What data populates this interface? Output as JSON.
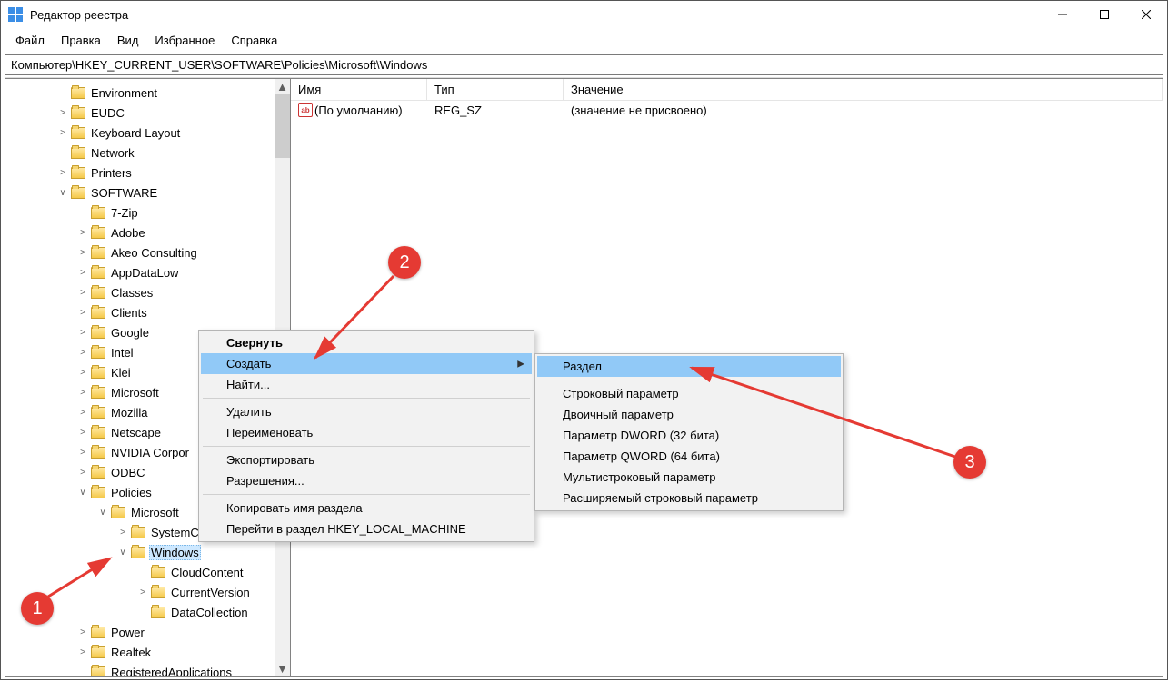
{
  "window": {
    "title": "Редактор реестра"
  },
  "menu": {
    "file": "Файл",
    "edit": "Правка",
    "view": "Вид",
    "favorites": "Избранное",
    "help": "Справка"
  },
  "address": "Компьютер\\HKEY_CURRENT_USER\\SOFTWARE\\Policies\\Microsoft\\Windows",
  "columns": {
    "name": "Имя",
    "type": "Тип",
    "value": "Значение"
  },
  "list": {
    "default_name": "(По умолчанию)",
    "default_type": "REG_SZ",
    "default_value": "(значение не присвоено)"
  },
  "tree": {
    "n0": "Environment",
    "n1": "EUDC",
    "n2": "Keyboard Layout",
    "n3": "Network",
    "n4": "Printers",
    "n5": "SOFTWARE",
    "n6": "7-Zip",
    "n7": "Adobe",
    "n8": "Akeo Consulting",
    "n9": "AppDataLow",
    "n10": "Classes",
    "n11": "Clients",
    "n12": "Google",
    "n13": "Intel",
    "n14": "Klei",
    "n15": "Microsoft",
    "n16": "Mozilla",
    "n17": "Netscape",
    "n18": "NVIDIA Corpor",
    "n19": "ODBC",
    "n20": "Policies",
    "n21": "Microsoft",
    "n22": "SystemCe",
    "n23": "Windows",
    "n24": "CloudContent",
    "n25": "CurrentVersion",
    "n26": "DataCollection",
    "n27": "Power",
    "n28": "Realtek",
    "n29": "RegisteredApplications"
  },
  "ctx1": {
    "i0": "Свернуть",
    "i1": "Создать",
    "i2": "Найти...",
    "i3": "Удалить",
    "i4": "Переименовать",
    "i5": "Экспортировать",
    "i6": "Разрешения...",
    "i7": "Копировать имя раздела",
    "i8": "Перейти в раздел HKEY_LOCAL_MACHINE"
  },
  "ctx2": {
    "i0": "Раздел",
    "i1": "Строковый параметр",
    "i2": "Двоичный параметр",
    "i3": "Параметр DWORD (32 бита)",
    "i4": "Параметр QWORD (64 бита)",
    "i5": "Мультистроковый параметр",
    "i6": "Расширяемый строковый параметр"
  },
  "callouts": {
    "c1": "1",
    "c2": "2",
    "c3": "3"
  }
}
